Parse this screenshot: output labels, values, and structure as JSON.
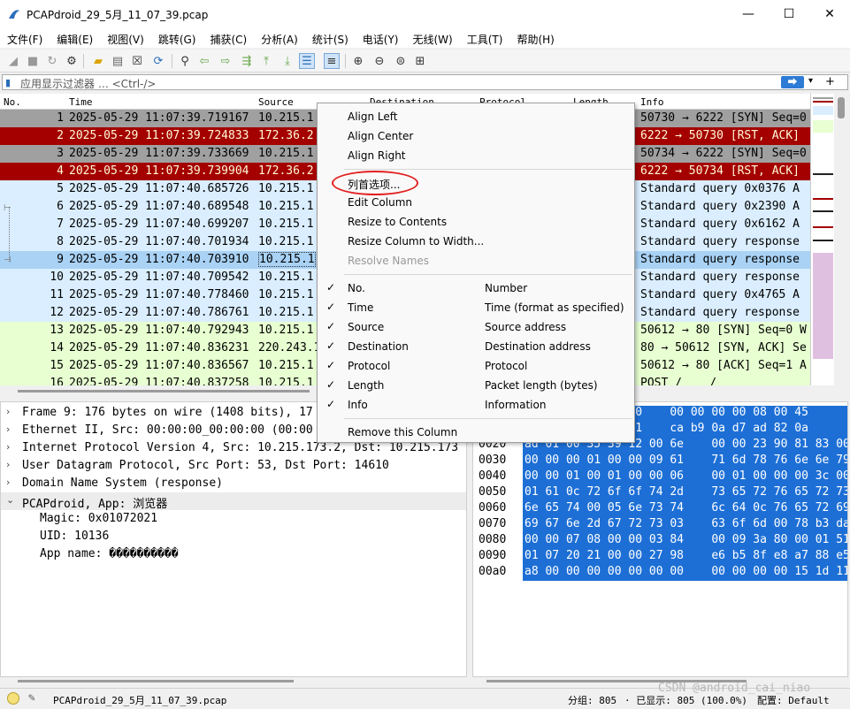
{
  "window": {
    "title": "PCAPdroid_29_5月_11_07_39.pcap",
    "minimize": "—",
    "maximize": "☐",
    "close": "✕"
  },
  "menu": [
    "文件(F)",
    "编辑(E)",
    "视图(V)",
    "跳转(G)",
    "捕获(C)",
    "分析(A)",
    "统计(S)",
    "电话(Y)",
    "无线(W)",
    "工具(T)",
    "帮助(H)"
  ],
  "toolbar_icons": [
    "shark-fin-start-icon",
    "stop-icon",
    "restart-icon",
    "options-icon",
    "open-folder-icon",
    "save-icon",
    "close-file-icon",
    "reload-icon",
    "find-icon",
    "back-icon",
    "forward-icon",
    "go-to-packet-icon",
    "first-packet-icon",
    "last-packet-icon",
    "autoscroll-icon",
    "colorize-icon",
    "zoom-in-icon",
    "zoom-out-icon",
    "zoom-normal-icon",
    "resize-columns-icon"
  ],
  "filter": {
    "placeholder": "应用显示过滤器 … <Ctrl-/>",
    "apply": "⮕",
    "dropdown": "▾",
    "plus": "+"
  },
  "columns": {
    "no": "No.",
    "time": "Time",
    "source": "Source",
    "destination": "Destination",
    "protocol": "Protocol",
    "length": "Length",
    "info": "Info"
  },
  "colors": {
    "tcp_gray": "#a0a0a0",
    "rst_red": "#a40000",
    "udp_blue": "#daeeff",
    "tcp_green": "#e7ffd1",
    "selected": "#a9d2f5",
    "hex_selected": "#1d6fd6",
    "annotation": "#e32020"
  },
  "packets": [
    {
      "no": "1",
      "time": "2025-05-29 11:07:39.719167",
      "source": "10.215.1",
      "info": "50730 → 6222 [SYN] Seq=0",
      "style": "gray"
    },
    {
      "no": "2",
      "time": "2025-05-29 11:07:39.724833",
      "source": "172.36.2",
      "info": "6222 → 50730 [RST, ACK]",
      "style": "red"
    },
    {
      "no": "3",
      "time": "2025-05-29 11:07:39.733669",
      "source": "10.215.1",
      "info": "50734 → 6222 [SYN] Seq=0",
      "style": "gray"
    },
    {
      "no": "4",
      "time": "2025-05-29 11:07:39.739904",
      "source": "172.36.2",
      "info": "6222 → 50734 [RST, ACK]",
      "style": "red"
    },
    {
      "no": "5",
      "time": "2025-05-29 11:07:40.685726",
      "source": "10.215.1",
      "info": "Standard query 0x0376 A",
      "style": "blue"
    },
    {
      "no": "6",
      "time": "2025-05-29 11:07:40.689548",
      "source": "10.215.1",
      "info": "Standard query 0x2390 A",
      "style": "blue"
    },
    {
      "no": "7",
      "time": "2025-05-29 11:07:40.699207",
      "source": "10.215.1",
      "info": "Standard query 0x6162 A",
      "style": "blue"
    },
    {
      "no": "8",
      "time": "2025-05-29 11:07:40.701934",
      "source": "10.215.1",
      "info": "Standard query response",
      "style": "blue"
    },
    {
      "no": "9",
      "time": "2025-05-29 11:07:40.703910",
      "source": "10.215.1",
      "info": "Standard query response",
      "style": "selected"
    },
    {
      "no": "10",
      "time": "2025-05-29 11:07:40.709542",
      "source": "10.215.1",
      "info": "Standard query response",
      "style": "blue"
    },
    {
      "no": "11",
      "time": "2025-05-29 11:07:40.778460",
      "source": "10.215.1",
      "info": "Standard query 0x4765 A",
      "style": "blue"
    },
    {
      "no": "12",
      "time": "2025-05-29 11:07:40.786761",
      "source": "10.215.1",
      "info": "Standard query response",
      "style": "blue"
    },
    {
      "no": "13",
      "time": "2025-05-29 11:07:40.792943",
      "source": "10.215.1",
      "info": "50612 → 80 [SYN] Seq=0 W",
      "style": "green"
    },
    {
      "no": "14",
      "time": "2025-05-29 11:07:40.836231",
      "source": "220.243.1",
      "info": "80 → 50612 [SYN, ACK] Se",
      "style": "green"
    },
    {
      "no": "15",
      "time": "2025-05-29 11:07:40.836567",
      "source": "10.215.1",
      "info": "50612 → 80 [ACK] Seq=1 A",
      "style": "green"
    },
    {
      "no": "16",
      "time": "2025-05-29 11:07:40.837258",
      "source": "10.215.1",
      "info": "POST /____/______",
      "style": "green"
    }
  ],
  "details": [
    {
      "arrow": "›",
      "text": "Frame 9: 176 bytes on wire (1408 bits), 17",
      "child": false,
      "hl": false
    },
    {
      "arrow": "›",
      "text": "Ethernet II, Src: 00:00:00_00:00:00 (00:00",
      "child": false,
      "hl": false
    },
    {
      "arrow": "›",
      "text": "Internet Protocol Version 4, Src: 10.215.173.2, Dst: 10.215.173",
      "child": false,
      "hl": false
    },
    {
      "arrow": "›",
      "text": "User Datagram Protocol, Src Port: 53, Dst Port: 14610",
      "child": false,
      "hl": false
    },
    {
      "arrow": "›",
      "text": "Domain Name System (response)",
      "child": false,
      "hl": false
    },
    {
      "arrow": "⌄",
      "text": "PCAPdroid, App: 浏览器",
      "child": false,
      "hl": true
    },
    {
      "arrow": "",
      "text": "Magic: 0x01072021",
      "child": true,
      "hl": false
    },
    {
      "arrow": "",
      "text": "UID: 10136",
      "child": true,
      "hl": false
    },
    {
      "arrow": "",
      "text": "App name: ����������",
      "child": true,
      "hl": false
    }
  ],
  "bytes": [
    {
      "off": "0000",
      "hex": "            00 00    00 00 00 00 08 00 45"
    },
    {
      "off": "0010",
      "hex": "            40 11    ca b9 0a d7 ad 82 0a"
    },
    {
      "off": "0020",
      "hex": "ad 01 00 35 39 12 00 6e    00 00 23 90 81 83 00"
    },
    {
      "off": "0030",
      "hex": "00 00 00 01 00 00 09 61    71 6d 78 76 6e 6e 79"
    },
    {
      "off": "0040",
      "hex": "00 00 01 00 01 00 00 06    00 01 00 00 00 3c 00"
    },
    {
      "off": "0050",
      "hex": "01 61 0c 72 6f 6f 74 2d    73 65 72 76 65 72 73"
    },
    {
      "off": "0060",
      "hex": "6e 65 74 00 05 6e 73 74    6c 64 0c 76 65 72 69"
    },
    {
      "off": "0070",
      "hex": "69 67 6e 2d 67 72 73 03    63 6f 6d 00 78 b3 da"
    },
    {
      "off": "0080",
      "hex": "00 00 07 08 00 00 03 84    00 09 3a 80 00 01 51"
    },
    {
      "off": "0090",
      "hex": "01 07 20 21 00 00 27 98    e6 b5 8f e8 a7 88 e5"
    },
    {
      "off": "00a0",
      "hex": "a8 00 00 00 00 00 00 00    00 00 00 00 15 1d 11"
    }
  ],
  "context_menu": {
    "top_items": [
      {
        "label": "Align Left",
        "disabled": false
      },
      {
        "label": "Align Center",
        "disabled": false
      },
      {
        "label": "Align Right",
        "disabled": false
      }
    ],
    "mid_items": [
      {
        "label": "列首选项...",
        "disabled": false
      },
      {
        "label": "Edit Column",
        "disabled": false
      },
      {
        "label": "Resize to Contents",
        "disabled": false
      },
      {
        "label": "Resize Column to Width...",
        "disabled": false
      },
      {
        "label": "Resolve Names",
        "disabled": true
      }
    ],
    "column_items": [
      {
        "label": "No.",
        "desc": "Number",
        "checked": true
      },
      {
        "label": "Time",
        "desc": "Time (format as specified)",
        "checked": true
      },
      {
        "label": "Source",
        "desc": "Source address",
        "checked": true
      },
      {
        "label": "Destination",
        "desc": "Destination address",
        "checked": true
      },
      {
        "label": "Protocol",
        "desc": "Protocol",
        "checked": true
      },
      {
        "label": "Length",
        "desc": "Packet length (bytes)",
        "checked": true
      },
      {
        "label": "Info",
        "desc": "Information",
        "checked": true
      }
    ],
    "remove": "Remove this Column",
    "check_glyph": "✓"
  },
  "status": {
    "file": "PCAPdroid_29_5月_11_07_39.pcap",
    "packets": "分组: 805",
    "displayed": "· 已显示: 805 (100.0%)",
    "profile": "配置: Default",
    "watermark": "CSDN @android_cai_niao"
  }
}
